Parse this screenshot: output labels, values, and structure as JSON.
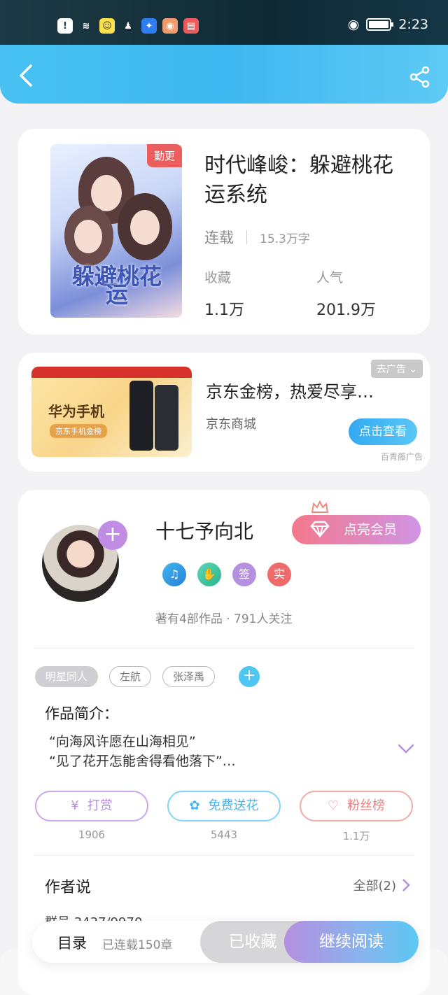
{
  "status": {
    "time": "2:23"
  },
  "book": {
    "badge": "勤更",
    "title": "时代峰峻：躲避桃花运系统",
    "state": "连载",
    "words": "15.3万字",
    "collect_label": "收藏",
    "collect_value": "1.1万",
    "pop_label": "人气",
    "pop_value": "201.9万",
    "cover_art_text": "躲避桃花运"
  },
  "ad": {
    "close_label": "去广告",
    "title": "京东金榜，热爱尽享…",
    "source": "京东商城",
    "button": "点击查看",
    "provider": "百青藤广告",
    "img_title": "华为手机",
    "img_sub": "京东手机金榜"
  },
  "author": {
    "name": "十七予向北",
    "vip_button": "点亮会员",
    "badge_sign": "签",
    "badge_real": "实",
    "stats": "著有4部作品 · 791人关注"
  },
  "tags": [
    "明星同人",
    "左航",
    "张泽禹"
  ],
  "intro": {
    "heading": "作品简介：",
    "line1": "“向海风许愿在山海相见”",
    "line2": "“见了花开怎能舍得看他落下”…"
  },
  "actions": [
    {
      "label": "打赏",
      "count": "1906",
      "color": "#b58fe0"
    },
    {
      "label": "免费送花",
      "count": "5443",
      "color": "#4fc6f2"
    },
    {
      "label": "粉丝榜",
      "count": "1.1万",
      "color": "#ef8a8a"
    }
  ],
  "author_says": {
    "heading": "作者说",
    "all": "全部(2)",
    "peek": "群号 3437/9970"
  },
  "bottom": {
    "toc": "目录",
    "chapters": "已连载150章",
    "collected": "已收藏",
    "read": "继续阅读"
  }
}
